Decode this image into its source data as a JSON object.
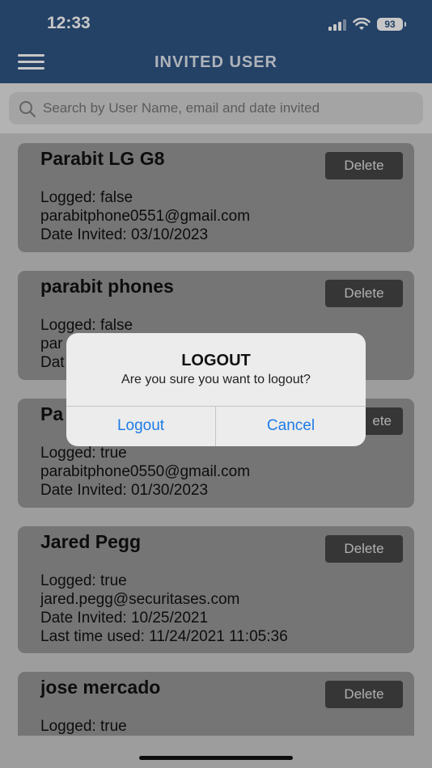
{
  "status": {
    "time": "12:33",
    "battery": "93"
  },
  "header": {
    "title": "INVITED USER",
    "menu_icon": "hamburger-menu-icon"
  },
  "search": {
    "placeholder": "Search by User Name, email and date invited",
    "value": ""
  },
  "users": [
    {
      "name": "Parabit LG G8",
      "delete_label": "Delete",
      "lines": [
        "Logged: false",
        "parabitphone0551@gmail.com",
        "Date Invited: 03/10/2023"
      ]
    },
    {
      "name": "parabit phones",
      "delete_label": "Delete",
      "lines": [
        "Logged: false",
        "par",
        "Dat"
      ]
    },
    {
      "name": "Pa",
      "delete_label": "ete",
      "lines": [
        "Logged: true",
        "parabitphone0550@gmail.com",
        "Date Invited: 01/30/2023"
      ]
    },
    {
      "name": "Jared Pegg",
      "delete_label": "Delete",
      "lines": [
        "Logged: true",
        "jared.pegg@securitases.com",
        "Date Invited: 10/25/2021",
        "Last time used: 11/24/2021 11:05:36"
      ]
    },
    {
      "name": "jose mercado",
      "delete_label": "Delete",
      "lines": [
        "Logged: true"
      ]
    }
  ],
  "dialog": {
    "title": "LOGOUT",
    "message": "Are you sure you want to logout?",
    "confirm_label": "Logout",
    "cancel_label": "Cancel"
  },
  "colors": {
    "header": "#2f5483",
    "card": "#979797",
    "delete_button": "#464646",
    "dialog_action": "#1d7ce6"
  }
}
